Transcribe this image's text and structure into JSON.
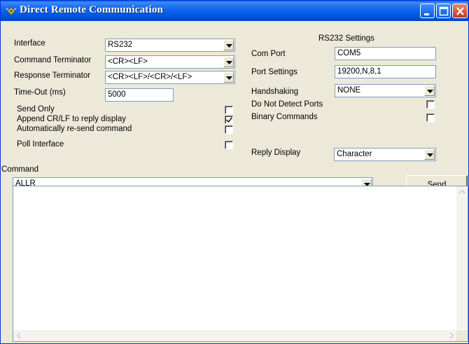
{
  "window": {
    "title": "Direct Remote Communication"
  },
  "left": {
    "interface_label": "Interface",
    "interface_value": "RS232",
    "command_terminator_label": "Command Terminator",
    "command_terminator_value": "<CR><LF>",
    "response_terminator_label": "Response Terminator",
    "response_terminator_value": "<CR><LF>/<CR>/<LF>",
    "timeout_label": "Time-Out (ms)",
    "timeout_value": "5000",
    "options": [
      {
        "label": "Send Only",
        "checked": false
      },
      {
        "label": "Append CR/LF to reply display",
        "checked": true
      },
      {
        "label": "Automatically re-send command",
        "checked": false
      },
      {
        "label": "Poll Interface",
        "checked": false
      }
    ]
  },
  "rs232": {
    "heading": "RS232 Settings",
    "com_port_label": "Com Port",
    "com_port_value": "COM5",
    "port_settings_label": "Port Settings",
    "port_settings_value": "19200,N,8,1",
    "handshaking_label": "Handshaking",
    "handshaking_value": "NONE",
    "do_not_detect_label": "Do Not Detect Ports",
    "do_not_detect_checked": false,
    "binary_commands_label": "Binary Commands",
    "binary_commands_checked": false
  },
  "reply": {
    "label": "Reply Display",
    "value": "Character"
  },
  "command": {
    "label": "Command",
    "value": "ALLR",
    "send_label": "Send"
  },
  "output": {
    "text": ""
  }
}
